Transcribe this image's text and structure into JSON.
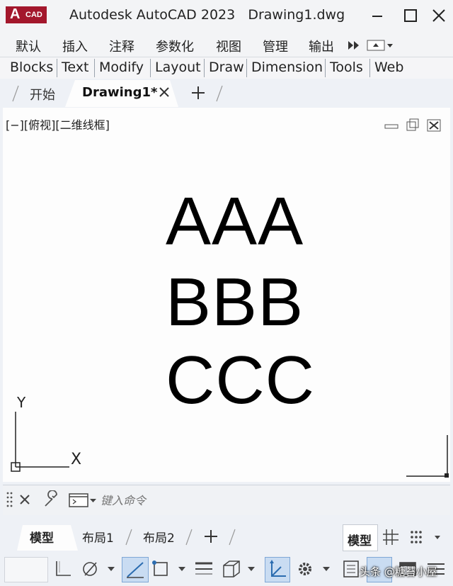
{
  "app": {
    "logo_letter": "A",
    "logo_text": "CAD",
    "title": "Autodesk AutoCAD 2023",
    "filename": "Drawing1.dwg"
  },
  "ribbon_tabs": [
    "默认",
    "插入",
    "注释",
    "参数化",
    "视图",
    "管理",
    "输出"
  ],
  "panel_tabs": [
    "Blocks",
    "Text",
    "Modify",
    "Layout",
    "Draw",
    "Dimension",
    "Tools",
    "Web"
  ],
  "file_tabs": {
    "start": "开始",
    "active": "Drawing1*"
  },
  "viewport": {
    "label": "[−][俯视][二维线框]",
    "lines": [
      "AAA",
      "BBB",
      "CCC"
    ],
    "ucs_y": "Y",
    "ucs_x": "X"
  },
  "command": {
    "placeholder": "键入命令"
  },
  "layout_tabs": {
    "model": "模型",
    "layout1": "布局1",
    "layout2": "布局2"
  },
  "status": {
    "model_label": "模型",
    "watermark": "头条 @糖苔小屋"
  },
  "colors": {
    "brand": "#a3172c",
    "accent": "#2b6cb0"
  }
}
